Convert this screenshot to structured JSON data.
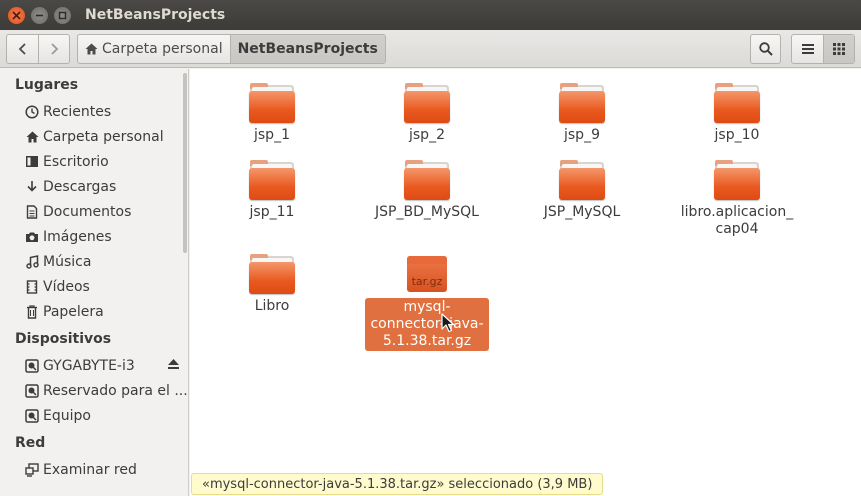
{
  "window": {
    "title": "NetBeansProjects"
  },
  "toolbar": {
    "breadcrumbs": [
      {
        "label": "Carpeta personal",
        "icon": "home-icon"
      },
      {
        "label": "NetBeansProjects"
      }
    ]
  },
  "sidebar": {
    "sections": [
      {
        "title": "Lugares",
        "items": [
          {
            "label": "Recientes",
            "icon": "clock-icon"
          },
          {
            "label": "Carpeta personal",
            "icon": "home-icon"
          },
          {
            "label": "Escritorio",
            "icon": "desktop-icon"
          },
          {
            "label": "Descargas",
            "icon": "download-icon"
          },
          {
            "label": "Documentos",
            "icon": "document-icon"
          },
          {
            "label": "Imágenes",
            "icon": "camera-icon"
          },
          {
            "label": "Música",
            "icon": "music-icon"
          },
          {
            "label": "Vídeos",
            "icon": "video-icon"
          },
          {
            "label": "Papelera",
            "icon": "trash-icon"
          }
        ]
      },
      {
        "title": "Dispositivos",
        "items": [
          {
            "label": "GYGABYTE-i3",
            "icon": "drive-icon"
          },
          {
            "label": "Reservado para el ...",
            "icon": "drive-icon"
          },
          {
            "label": "Equipo",
            "icon": "drive-icon"
          }
        ]
      },
      {
        "title": "Red",
        "items": [
          {
            "label": "Examinar red",
            "icon": "network-icon"
          }
        ]
      }
    ]
  },
  "files": [
    {
      "name": "jsp_1",
      "type": "folder"
    },
    {
      "name": "jsp_2",
      "type": "folder"
    },
    {
      "name": "jsp_9",
      "type": "folder"
    },
    {
      "name": "jsp_10",
      "type": "folder"
    },
    {
      "name": "jsp_11",
      "type": "folder"
    },
    {
      "name": "JSP_BD_MySQL",
      "type": "folder"
    },
    {
      "name": "JSP_MySQL",
      "type": "folder"
    },
    {
      "name": "libro.aplicacion_ cap04",
      "type": "folder"
    },
    {
      "name": "Libro",
      "type": "folder"
    },
    {
      "name": "mysql-connector- java-5.1.38.tar.gz",
      "type": "archive",
      "ext": "tar.gz",
      "selected": true
    }
  ],
  "status": {
    "text": "«mysql-connector-java-5.1.38.tar.gz» seleccionado  (3,9 MB)"
  },
  "colors": {
    "accent": "#e0703f",
    "titlebar": "#3c3b37",
    "close": "#e0531d"
  }
}
